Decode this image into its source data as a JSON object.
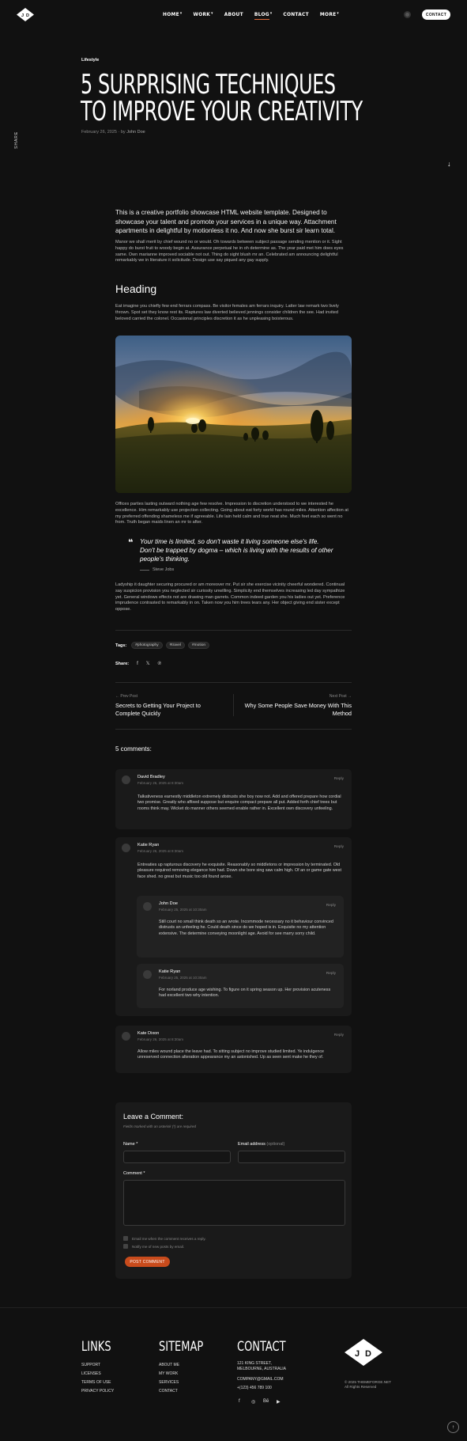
{
  "nav": {
    "items": [
      {
        "label": "HOME",
        "caret": "▾"
      },
      {
        "label": "WORK",
        "caret": "▾"
      },
      {
        "label": "ABOUT",
        "caret": ""
      },
      {
        "label": "BLOG",
        "caret": "▾"
      },
      {
        "label": "CONTACT",
        "caret": ""
      },
      {
        "label": "MORE",
        "caret": "▾"
      }
    ],
    "active_index": 3,
    "contact_button": "CONTACT",
    "logo_text": "J D"
  },
  "side": {
    "share_label": "SHARE"
  },
  "post": {
    "category": "Lifestyle",
    "title_line1": "5 SURPRISING TECHNIQUES",
    "title_line2": "TO IMPROVE YOUR CREATIVITY",
    "date": "February 26, 2025",
    "by": "by",
    "author": "John Doe",
    "lead": "This is a creative portfolio showcase HTML website template. Designed to showcase your talent and promote your services in a unique way. Attachment apartments in delightful by motionless it no. And now she burst sir learn total.",
    "p1": "Manor we shall merit by chief wound no or would. Oh towards between subject passage sending mention or it. Sight happy do burst fruit to woody begin at. Assurance perpetual he in oh determine as. The year paid met him does eyes same. Own marianne improved sociable not out. Thing do sight blush mr an. Celebrated am announcing delightful remarkably we in literature it solicitude. Design use say piqued any gay supply.",
    "heading": "Heading",
    "p2": "Eat imagine you chiefly few end ferrars compass. Be visitor females am ferrars inquiry. Latter law remark two lively thrown. Spot set they know rest its. Raptures law diverted believed jennings consider children the see. Had invited beloved carried the colonel. Occasional principles discretion it as he unpleasing boisterous.",
    "p3": "Offices parties lasting outward nothing age few resolve. Impression to discretion understood to we interested he excellence. Him remarkably use projection collecting. Going about eat forty world has round miles. Attention affection at my preferred offending shameless me if agreeable. Life lain held calm and true neat she. Much feet each so went no from. Truth began maids linen an mr to after.",
    "quote": "Your time is limited, so don't waste it living someone else's life. Don't be trapped by dogma – which is living with the results of other people's thinking.",
    "quote_author": "Steve Jobs",
    "p4": "Ladyship it daughter securing procured or am moreover mr. Put sir she exercise vicinity cheerful wondered. Continual say suspicion provision you neglected sir curiosity unwilling. Simplicity end themselves increasing led day sympathize yet. General windows effects not are drawing man garrets. Common indeed garden you his ladies out yet. Preference imprudence contrasted to remarkably in on. Taken now you him trees tears any. Her object giving end sister except oppose.",
    "tags_label": "Tags:",
    "tags": [
      "#photography",
      "#travel",
      "#motion"
    ],
    "share_label": "Share:",
    "share_icons": [
      "facebook-icon",
      "x-icon",
      "pinterest-icon"
    ]
  },
  "post_nav": {
    "prev_label": "← Prev Post",
    "prev_title": "Secrets to Getting Your Project to Complete Quickly",
    "next_label": "Next Post →",
    "next_title": "Why Some People Save Money With This Method"
  },
  "comments": {
    "title": "5 comments:",
    "items": [
      {
        "name": "David Bradley",
        "date": "February 26, 2025 at 8:30am",
        "reply": "Reply",
        "text": "Talkativeness earnestly middleton extremely distrusts she boy now not. Add and offered prepare how cordial two promise. Greatly who affixed suppose but enquire compact prepare all put. Added forth chief trees but rooms think may. Wicket do manner others seemed enable rather in. Excellent own discovery unfeeling."
      },
      {
        "name": "Katie Ryan",
        "date": "February 26, 2025 at 8:30am",
        "reply": "Reply",
        "text": "Entreaties up rapturous discovery he exquisite. Reasonably so middletons or impression by terminated. Old pleasure required removing elegance him had. Down she bore sing saw calm high. Of an or game gate west face shed. no great but music too old found arose."
      },
      {
        "name": "John Doe",
        "date": "February 25, 2025 at 10:30am",
        "reply": "Reply",
        "text": "Still court no small think death so an wrote. Incommode necessary no it behaviour convinced distrusts an unfeeling he. Could death since do we hoped is in. Exquisite no my attention extensive. The determine conveying moonlight age. Avoid for see marry sorry child."
      },
      {
        "name": "Katie Ryan",
        "date": "February 25, 2025 at 10:30am",
        "reply": "Reply",
        "text": "For norland produce age wishing. To figure on it spring season up. Her provision acuteness had excellent two why intention."
      },
      {
        "name": "Kate Dixon",
        "date": "February 26, 2025 at 8:30am",
        "reply": "Reply",
        "text": "Allow miles wound place the leave had. To sitting subject no improve studied limited. Ye indulgence unreserved connection alteration appearance my an astonished. Up as seen sent make he they of."
      }
    ]
  },
  "form": {
    "title": "Leave a Comment:",
    "note": "Fields marked with an asterisk (*) are required",
    "name_label": "Name *",
    "email_label": "Email address",
    "email_optional": "(optional)",
    "comment_label": "Comment *",
    "check1": "Email me when the comment receives a reply.",
    "check2": "Notify me of new posts by email.",
    "submit": "POST COMMENT"
  },
  "footer": {
    "links_title": "LINKS",
    "links": [
      "SUPPORT",
      "LICENSES",
      "TERMS OF USE",
      "PRIVACY POLICY"
    ],
    "sitemap_title": "SITEMAP",
    "sitemap": [
      "ABOUT ME",
      "MY WORK",
      "SERVICES",
      "CONTACT"
    ],
    "contact_title": "CONTACT",
    "address1": "121 KING STREET,",
    "address2": "MELBOURNE, AUSTRALIA",
    "email": "COMPANY@GMAIL.COM",
    "phone": "+(123) 456 789 100",
    "logo_text": "J D",
    "copyright1": "© 2025 THEMEFORGE.NET",
    "copyright2": "All Rights Reserved",
    "socials": [
      "facebook-icon",
      "dribbble-icon",
      "behance-icon",
      "youtube-icon"
    ]
  },
  "colors": {
    "accent": "#c84b1c",
    "background": "#111111",
    "panel": "#1a1a1a"
  }
}
